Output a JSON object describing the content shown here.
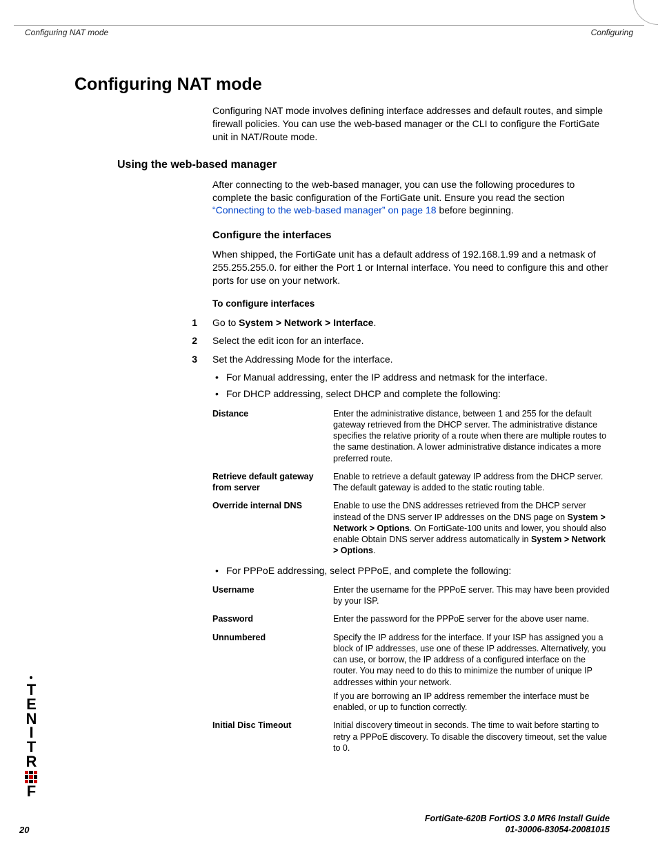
{
  "header": {
    "left": "Configuring NAT mode",
    "right": "Configuring"
  },
  "title": "Configuring NAT mode",
  "paragraphs": {
    "intro": "Configuring NAT mode involves defining interface addresses and default routes, and simple firewall policies. You can use the web-based manager or the CLI to configure the FortiGate unit in NAT/Route mode.",
    "using_h2": "Using the web-based manager",
    "using_body_pre": "After connecting to the web-based manager, you can use the following procedures to complete the basic configuration of the FortiGate unit. Ensure you read the section ",
    "using_link": "“Connecting to the web-based manager” on page 18",
    "using_body_post": " before beginning.",
    "configure_h3": "Configure the interfaces",
    "configure_body": "When shipped, the FortiGate unit has a default address of 192.168.1.99 and a netmask of 255.255.255.0. for either the Port 1 or Internal interface. You need to configure this and other ports for use on your network.",
    "procedure_h4": "To configure interfaces"
  },
  "steps": [
    {
      "n": "1",
      "pre": "Go to ",
      "bold": "System > Network > Interface",
      "post": "."
    },
    {
      "n": "2",
      "pre": "Select the edit icon for an interface.",
      "bold": "",
      "post": ""
    },
    {
      "n": "3",
      "pre": "Set the Addressing Mode for the interface.",
      "bold": "",
      "post": ""
    }
  ],
  "sub_bullets_a": [
    "For Manual addressing, enter the IP address and netmask for the interface.",
    "For DHCP addressing, select DHCP and complete the following:"
  ],
  "dhcp_table": [
    {
      "label": "Distance",
      "desc": "Enter the administrative distance, between 1 and 255 for the default gateway retrieved from the DHCP server. The administrative distance specifies the relative priority of a route when there are multiple routes to the same destination. A lower administrative distance indicates a more preferred route."
    },
    {
      "label": "Retrieve default gateway from server",
      "desc": "Enable to retrieve a default gateway IP address from the DHCP server. The default gateway is added to the static routing table."
    },
    {
      "label": "Override internal DNS",
      "desc_parts": {
        "p1": "Enable to use the DNS addresses retrieved from the DHCP server instead of the DNS server IP addresses on the DNS page on ",
        "b1": "System > Network > Options",
        "p2": ". On FortiGate-100 units and lower, you should also enable Obtain DNS server address automatically in ",
        "b2": "System > Network > Options",
        "p3": "."
      }
    }
  ],
  "pppoe_bullet": "For PPPoE addressing, select PPPoE, and complete the following:",
  "pppoe_table": [
    {
      "label": "Username",
      "desc": "Enter the username for the PPPoE server. This may have been provided by your ISP."
    },
    {
      "label": "Password",
      "desc": "Enter the password for the PPPoE server for the above user name."
    },
    {
      "label": "Unnumbered",
      "desc": "Specify the IP address for the interface. If your ISP has assigned you a block of IP addresses, use one of these IP addresses. Alternatively, you can use, or borrow, the IP address of a configured interface on the router. You may need to do this to minimize the number of unique IP addresses within your network.",
      "extra": "If you are borrowing an IP address remember the interface must be enabled, or up to function correctly."
    },
    {
      "label": "Initial Disc Timeout",
      "desc": "Initial discovery timeout in seconds. The time to wait before starting to retry a PPPoE discovery. To disable the discovery timeout, set the value to 0."
    }
  ],
  "logo_letters": [
    "T",
    "E",
    "N",
    "I",
    "T",
    "R",
    "F"
  ],
  "footer": {
    "line1": "FortiGate-620B FortiOS 3.0 MR6 Install Guide",
    "line2": "01-30006-83054-20081015",
    "page": "20"
  }
}
